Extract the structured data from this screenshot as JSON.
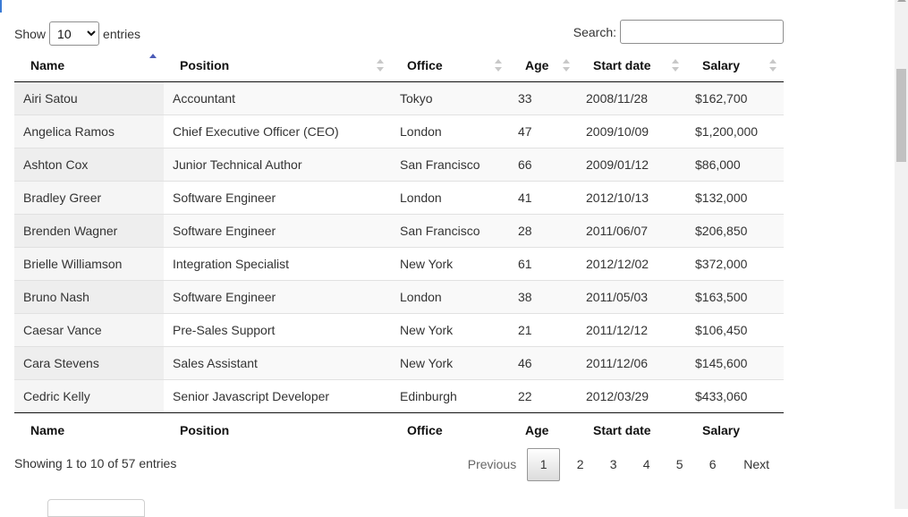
{
  "length": {
    "prefix": "Show",
    "selected": "10",
    "suffix": "entries"
  },
  "search": {
    "label": "Search:",
    "value": ""
  },
  "columns": [
    "Name",
    "Position",
    "Office",
    "Age",
    "Start date",
    "Salary"
  ],
  "rows": [
    [
      "Airi Satou",
      "Accountant",
      "Tokyo",
      "33",
      "2008/11/28",
      "$162,700"
    ],
    [
      "Angelica Ramos",
      "Chief Executive Officer (CEO)",
      "London",
      "47",
      "2009/10/09",
      "$1,200,000"
    ],
    [
      "Ashton Cox",
      "Junior Technical Author",
      "San Francisco",
      "66",
      "2009/01/12",
      "$86,000"
    ],
    [
      "Bradley Greer",
      "Software Engineer",
      "London",
      "41",
      "2012/10/13",
      "$132,000"
    ],
    [
      "Brenden Wagner",
      "Software Engineer",
      "San Francisco",
      "28",
      "2011/06/07",
      "$206,850"
    ],
    [
      "Brielle Williamson",
      "Integration Specialist",
      "New York",
      "61",
      "2012/12/02",
      "$372,000"
    ],
    [
      "Bruno Nash",
      "Software Engineer",
      "London",
      "38",
      "2011/05/03",
      "$163,500"
    ],
    [
      "Caesar Vance",
      "Pre-Sales Support",
      "New York",
      "21",
      "2011/12/12",
      "$106,450"
    ],
    [
      "Cara Stevens",
      "Sales Assistant",
      "New York",
      "46",
      "2011/12/06",
      "$145,600"
    ],
    [
      "Cedric Kelly",
      "Senior Javascript Developer",
      "Edinburgh",
      "22",
      "2012/03/29",
      "$433,060"
    ]
  ],
  "info": "Showing 1 to 10 of 57 entries",
  "pagination": {
    "previous": "Previous",
    "pages": [
      "1",
      "2",
      "3",
      "4",
      "5",
      "6"
    ],
    "current": "1",
    "next": "Next"
  }
}
